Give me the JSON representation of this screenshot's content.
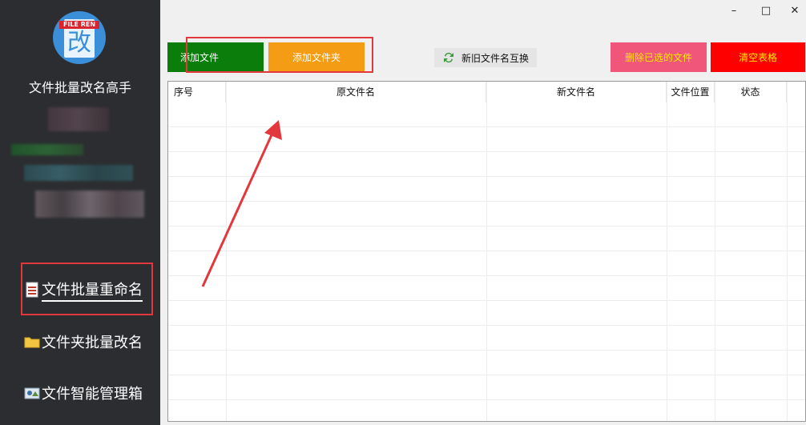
{
  "sidebar": {
    "logo_banner": "FILE REN",
    "logo_char": "改",
    "app_title": "文件批量改名高手",
    "nav": [
      {
        "label": "文件批量重命名",
        "active": true
      },
      {
        "label": "文件夹批量改名",
        "active": false
      },
      {
        "label": "文件智能管理箱",
        "active": false
      }
    ]
  },
  "window": {
    "minimize": "–",
    "maximize": "□",
    "close": "✕"
  },
  "toolbar": {
    "add_file": "添加文件",
    "add_folder": "添加文件夹",
    "swap_names": "新旧文件名互换",
    "delete_selected": "删除已选的文件",
    "clear_table": "清空表格"
  },
  "table": {
    "columns": [
      "序号",
      "原文件名",
      "新文件名",
      "文件位置",
      "状态"
    ]
  },
  "colors": {
    "sidebar_bg": "#2b2d30",
    "add_file_bg": "#0a7d0a",
    "add_folder_bg": "#f39c14",
    "delete_bg": "#f0567a",
    "clear_bg": "#ff0000",
    "highlight": "#e2383d"
  },
  "icons": {
    "file_list": "file-list-icon",
    "folder": "folder-icon",
    "manager": "manager-box-icon",
    "swap": "swap-arrows-icon",
    "annotation_arrow": "annotation-arrow-icon"
  }
}
